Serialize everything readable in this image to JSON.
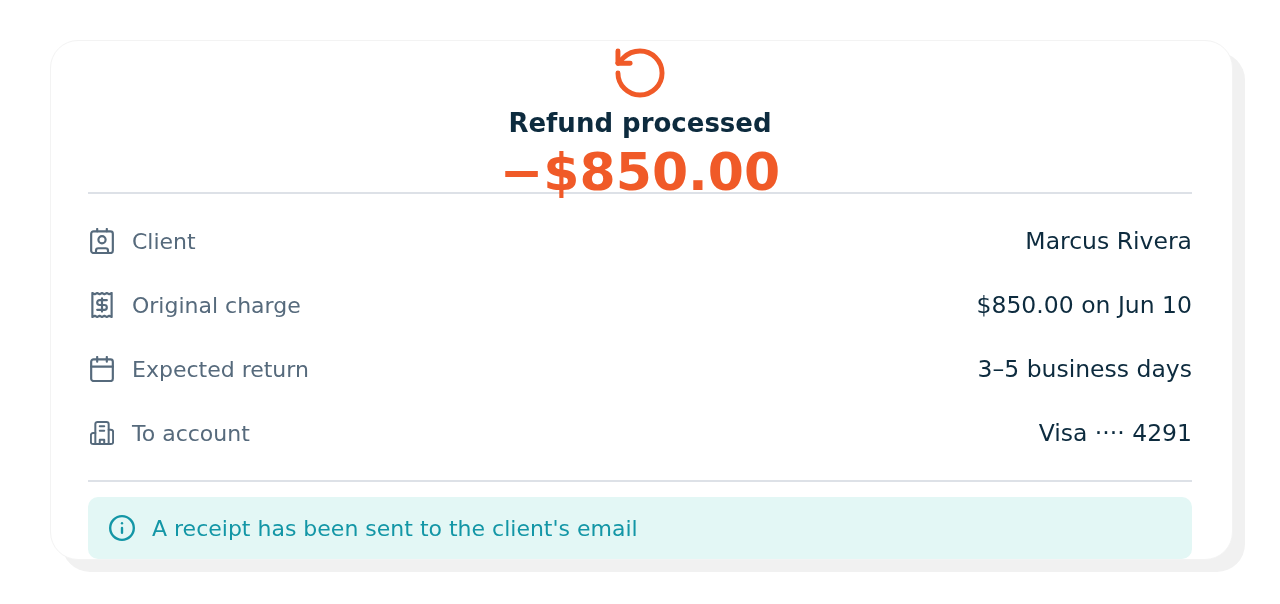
{
  "header": {
    "title": "Refund processed",
    "amount": "−$850.00"
  },
  "details": [
    {
      "kind": "client",
      "label": "Client",
      "value": "Marcus Rivera"
    },
    {
      "kind": "charge",
      "label": "Original charge",
      "value": "$850.00 on Jun 10"
    },
    {
      "kind": "calendar",
      "label": "Expected return",
      "value": "3–5 business days"
    },
    {
      "kind": "account",
      "label": "To account",
      "value": "Visa ···· 4291"
    }
  ],
  "notice": {
    "text": "A receipt has been sent to the client's email"
  }
}
